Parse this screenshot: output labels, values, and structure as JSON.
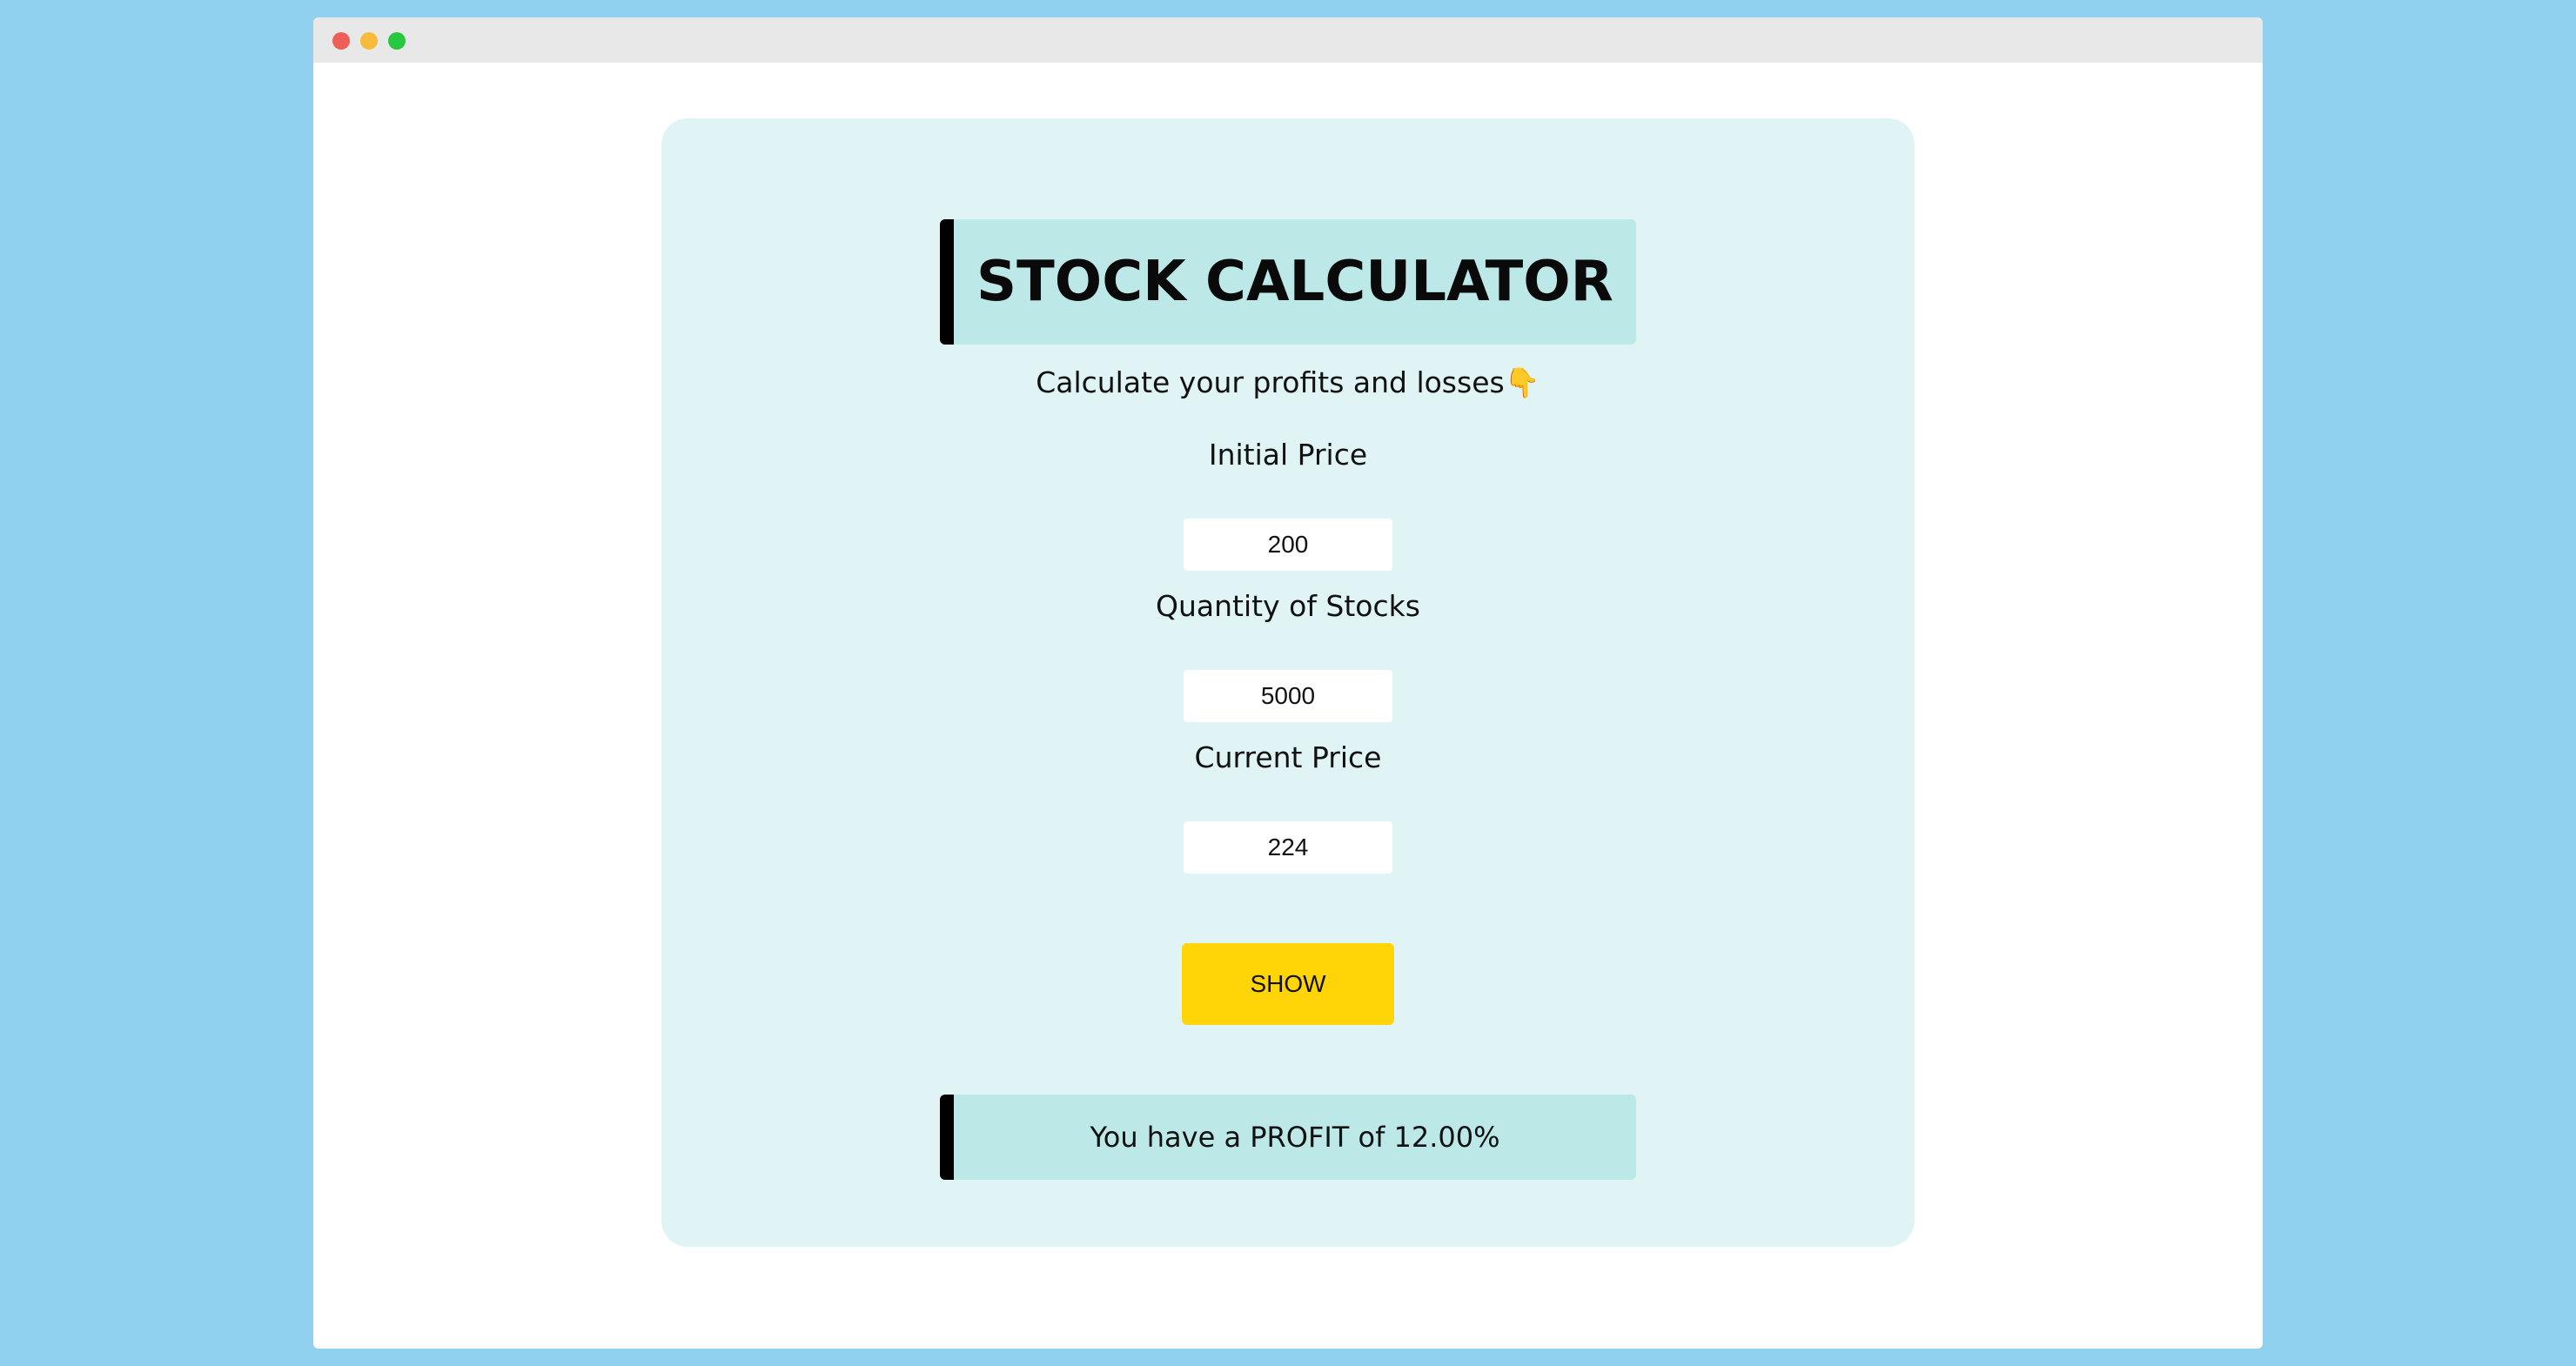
{
  "window": {
    "controls": [
      "close",
      "minimize",
      "maximize"
    ]
  },
  "header": {
    "title": "STOCK CALCULATOR",
    "subtitle": "Calculate your profits and losses👇"
  },
  "form": {
    "initial_price": {
      "label": "Initial Price",
      "value": "200"
    },
    "quantity": {
      "label": "Quantity of Stocks",
      "value": "5000"
    },
    "current_price": {
      "label": "Current Price",
      "value": "224"
    }
  },
  "actions": {
    "show_label": "SHOW"
  },
  "result": {
    "message": "You have a PROFIT of 12.00%"
  },
  "colors": {
    "page_background": "#8fd1ee",
    "card_background": "#e0f4f5",
    "banner_background": "#bce8e7",
    "banner_accent": "#000000",
    "button": "#ffd507"
  }
}
